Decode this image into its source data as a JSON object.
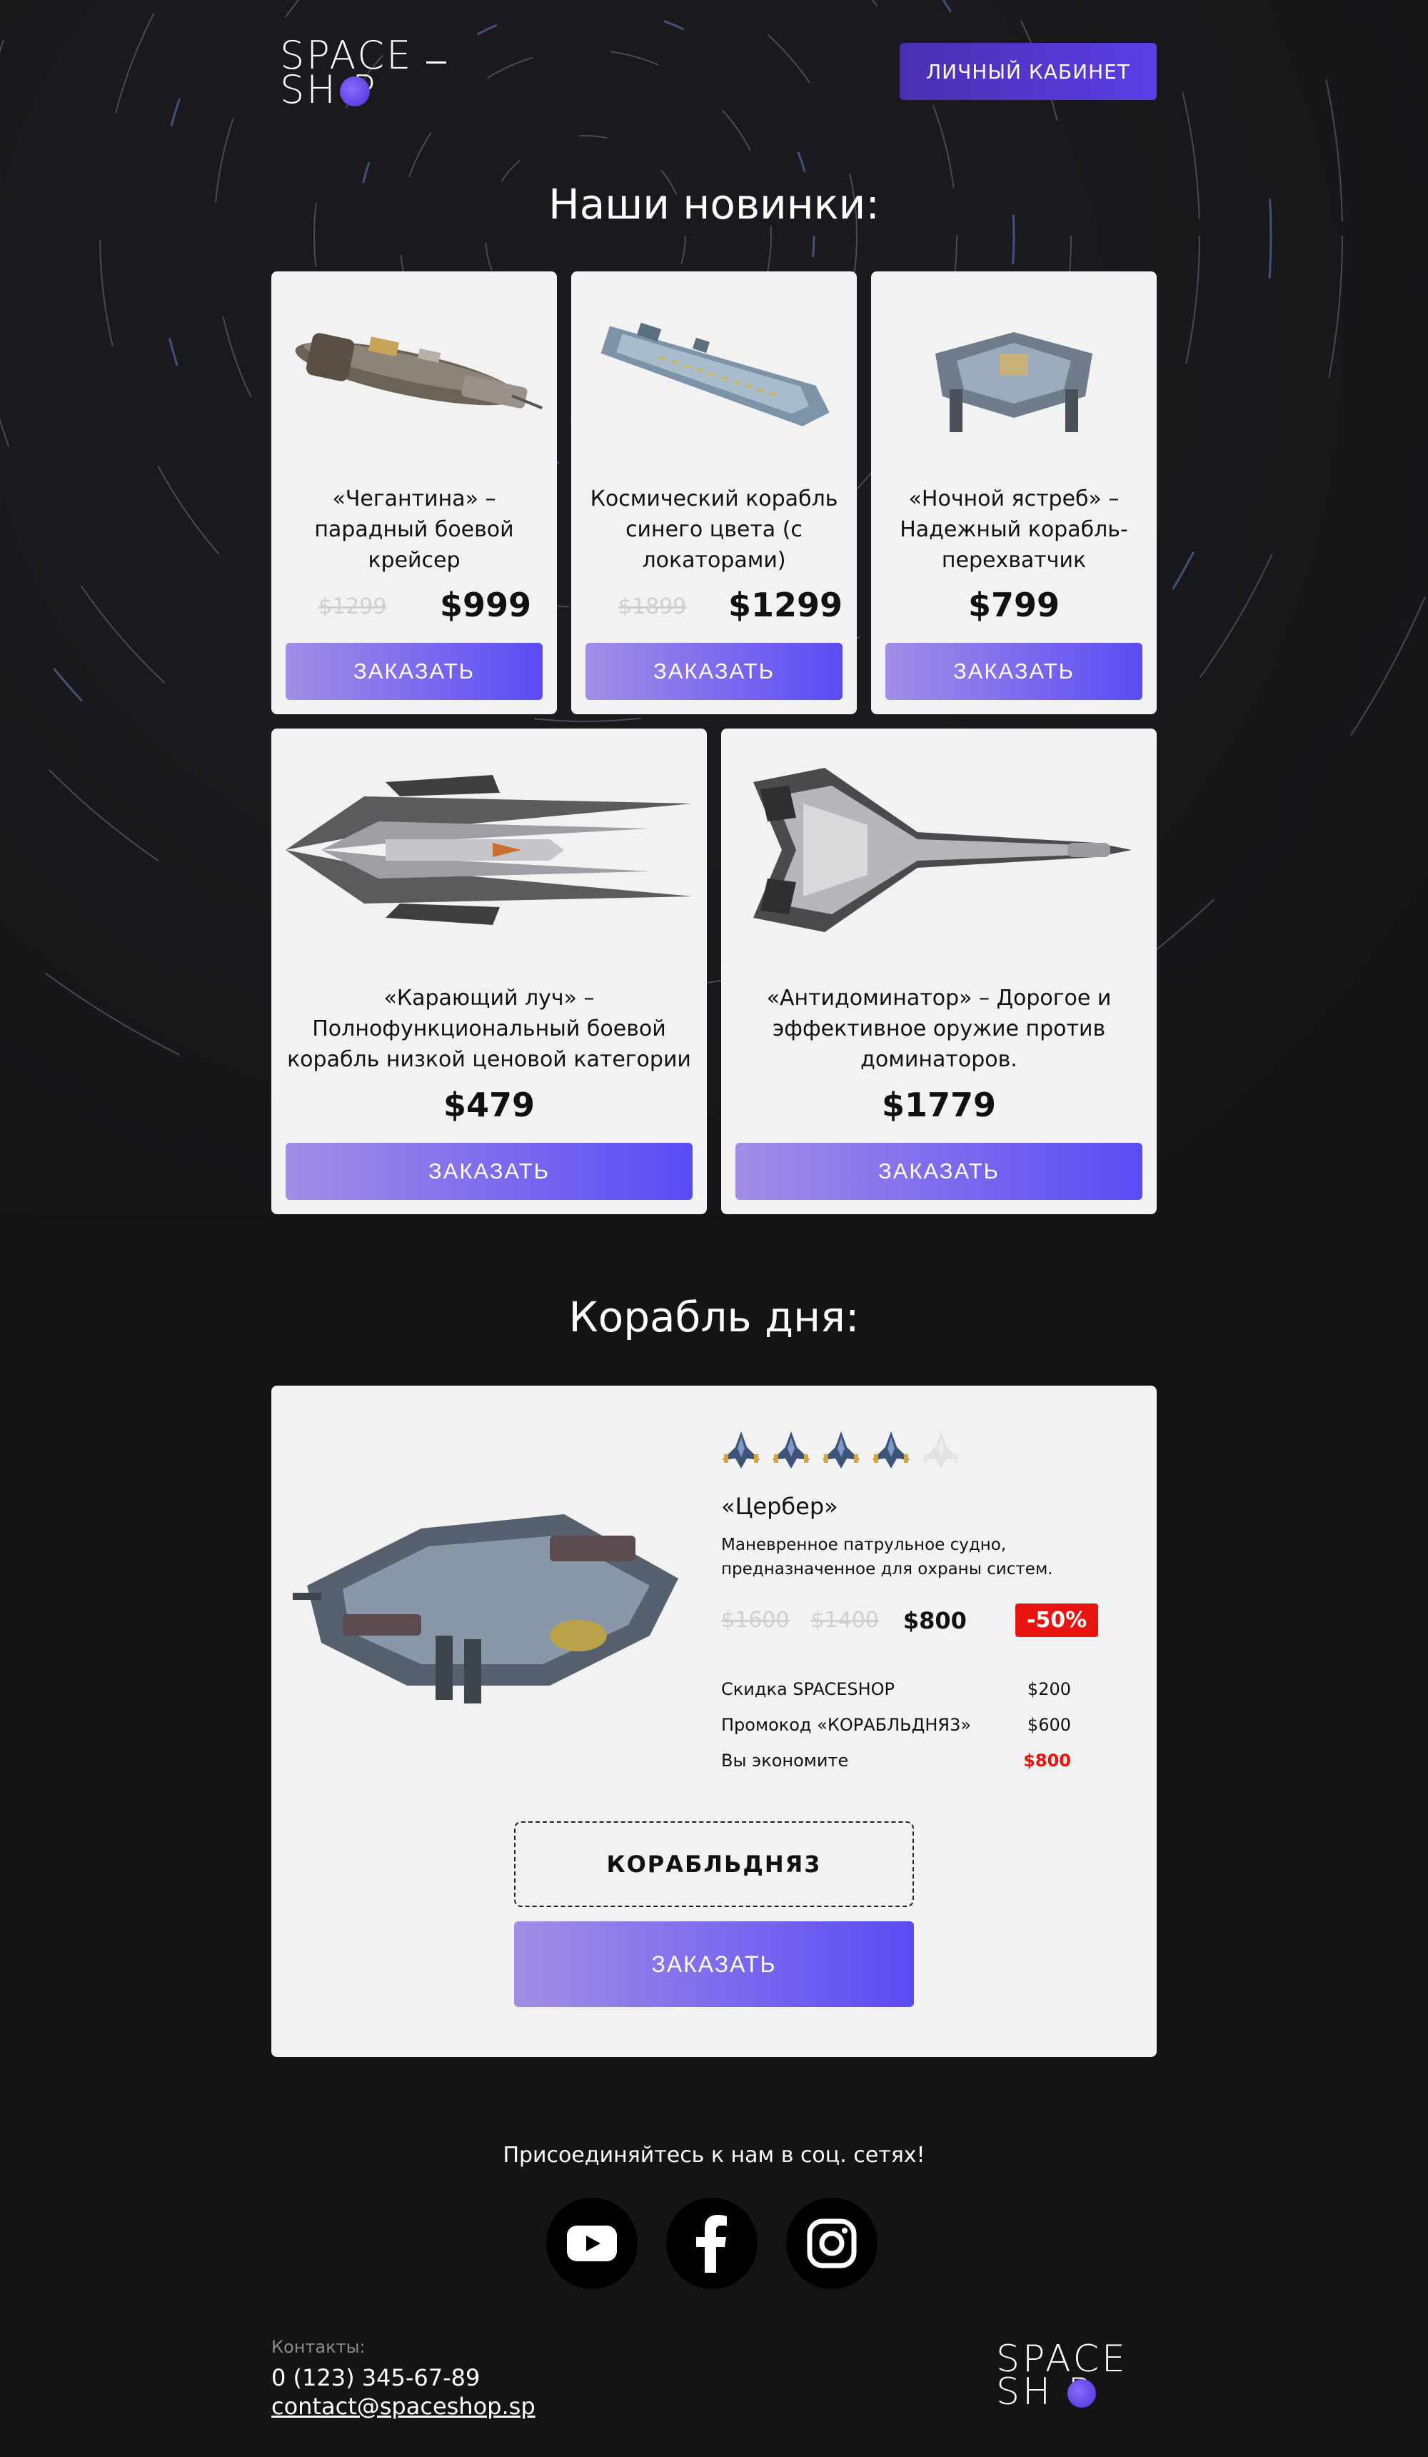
{
  "header": {
    "logo_line1": "SPACE",
    "logo_line2": "SH  P",
    "cabinet_label": "ЛИЧНЫЙ КАБИНЕТ"
  },
  "news": {
    "title": "Наши новинки:",
    "items": [
      {
        "desc": "«Чегантина» – парадный боевой крейсер",
        "old_price": "$1299",
        "price": "$999",
        "button": "ЗАКАЗАТЬ",
        "image_icon": "cruiser-ship-image"
      },
      {
        "desc": "Космический корабль синего цвета (с локаторами)",
        "old_price": "$1899",
        "price": "$1299",
        "button": "ЗАКАЗАТЬ",
        "image_icon": "blue-ship-image"
      },
      {
        "desc": "«Ночной ястреб» – Надежный корабль-перехватчик",
        "old_price": "",
        "price": "$799",
        "button": "ЗАКАЗАТЬ",
        "image_icon": "hawk-ship-image"
      },
      {
        "desc": "«Карающий луч» – Полнофункциональный боевой корабль низкой ценовой категории",
        "old_price": "",
        "price": "$479",
        "button": "ЗАКАЗАТЬ",
        "image_icon": "ray-ship-image"
      },
      {
        "desc": "«Антидоминатор» – Дорогое и эффективное оружие против доминаторов.",
        "old_price": "",
        "price": "$1779",
        "button": "ЗАКАЗАТЬ",
        "image_icon": "fighter-ship-image"
      }
    ]
  },
  "ship_of_day": {
    "title": "Корабль дня:",
    "rating": 4,
    "rating_max": 5,
    "name": "«Цербер»",
    "description": "Маневренное патрульное судно, предназначенное для охраны систем.",
    "old_price_1": "$1600",
    "old_price_2": "$1400",
    "price": "$800",
    "discount": "-50%",
    "summary": [
      {
        "label": "Скидка SPACESHOP",
        "value": "$200"
      },
      {
        "label": "Промокод «КОРАБЛЬДНЯ3»",
        "value": "$600"
      },
      {
        "label": "Вы экономите",
        "value": "$800"
      }
    ],
    "promo_code": "КОРАБЛЬДНЯ3",
    "button": "ЗАКАЗАТЬ",
    "colors": {
      "discount_red": "#e8140f",
      "button_start": "#a28ee6",
      "button_end": "#5a4bf5"
    }
  },
  "social": {
    "title": "Присоединяйтесь к нам в соц. сетях!",
    "icons": [
      "youtube-icon",
      "facebook-icon",
      "instagram-icon"
    ]
  },
  "footer": {
    "contacts_label": "Контакты:",
    "phone": "0 (123) 345-67-89",
    "email": "contact@spaceshop.sp",
    "logo_line1": "SPACE",
    "logo_line2": "SH  P"
  }
}
